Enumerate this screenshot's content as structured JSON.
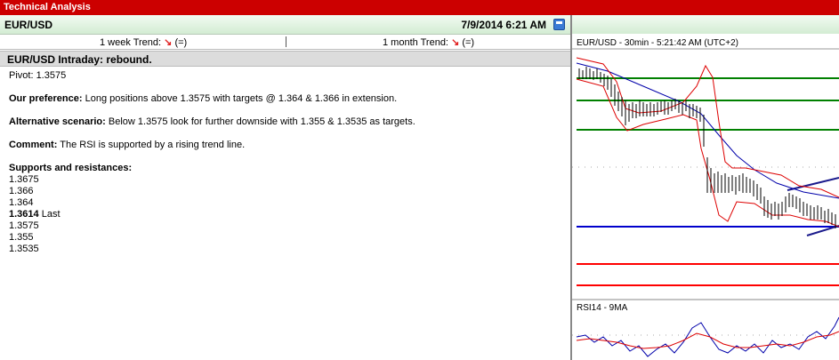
{
  "window": {
    "title": "Technical Analysis"
  },
  "header": {
    "symbol": "EUR/USD",
    "datetime": "7/9/2014 6:21 AM",
    "save_icon": "save-icon"
  },
  "trends": {
    "week_label": "1 week Trend:",
    "week_arrow": "↘",
    "week_value": "(=)",
    "month_label": "1 month Trend:",
    "month_arrow": "↘",
    "month_value": "(=)",
    "arrow_color": "#e02020"
  },
  "analysis": {
    "headline": "EUR/USD Intraday: rebound.",
    "pivot": "Pivot: 1.3575",
    "preference_label": "Our preference:",
    "preference_text": " Long positions above 1.3575 with targets @ 1.364 & 1.366 in extension.",
    "alternative_label": "Alternative scenario:",
    "alternative_text": " Below 1.3575 look for further downside with 1.355 & 1.3535 as targets.",
    "comment_label": "Comment:",
    "comment_text": " The RSI is supported by a rising trend line.",
    "sr_label": "Supports and resistances:",
    "levels": [
      "1.3675",
      "1.366",
      "1.364"
    ],
    "last_value": "1.3614",
    "last_label": " Last",
    "levels_below": [
      "1.3575",
      "1.355",
      "1.3535"
    ]
  },
  "chart": {
    "title": "EUR/USD - 30min - 5:21:42 AM (UTC+2)",
    "rsi_title": "RSI14 - 9MA",
    "colors": {
      "resistance": "#008000",
      "support": "#ff0000",
      "pivot": "#0000cc",
      "band": "#dd0000",
      "ma": "#0000aa"
    }
  }
}
